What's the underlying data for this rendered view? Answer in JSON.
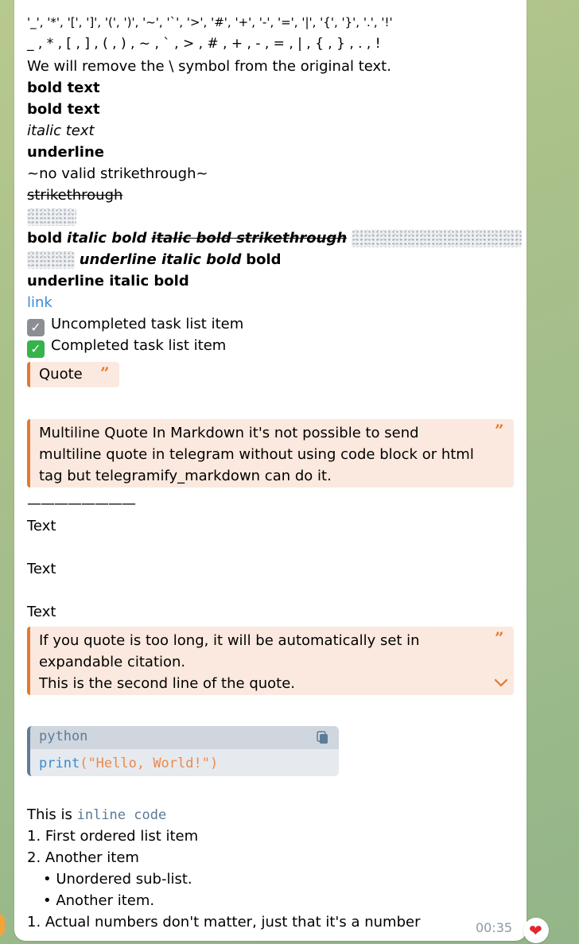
{
  "escaped_chars": "'_', '*', '[', ']', '(', ')', '~', '`', '>', '#', '+', '-', '=', '|', '{', '}', '.', '!'",
  "symbols_line": "_ , * , [ , ] , ( , ) , ~ , ` , > , # , + , - , = , | , { , } , . , !",
  "remove_backslash": "We will remove the \\ symbol from the original text.",
  "bold1": "bold text",
  "bold2": "bold text",
  "italic": "italic text",
  "underline": "underline",
  "no_strike": "~no valid strikethrough~",
  "strike": "strikethrough",
  "mixed_line": {
    "bold": "bold",
    "italic_bold": "italic bold",
    "italic_bold_strike": "italic bold strikethrough"
  },
  "mixed_line2": {
    "underline_italic_bold": "underline italic bold",
    "bold": "bold"
  },
  "underline_italic_bold": "underline italic bold",
  "link": "link",
  "tasks": [
    {
      "label": "Uncompleted task list item",
      "icon": "checkmark-grey-icon"
    },
    {
      "label": "Completed task list item",
      "icon": "checkmark-green-icon"
    }
  ],
  "quote_short": "Quote",
  "quote_multiline": [
    "Multiline Quote In Markdown it's not possible to send",
    "multiline quote in telegram without using code block or html",
    "tag but telegramify_markdown can do it."
  ],
  "hr": "————————",
  "text_lines": [
    "Text",
    "Text",
    "Text"
  ],
  "quote_expandable": [
    "If you quote is too long, it will be automatically set in",
    "expandable citation.",
    "This is the second line of the quote."
  ],
  "code": {
    "language": "python",
    "func": "print",
    "paren_open": "(",
    "string": "\"Hello, World!\"",
    "paren_close": ")"
  },
  "inline_code_prefix": "This is ",
  "inline_code": "inline code",
  "list": [
    "1. First ordered list item",
    "2. Another item",
    "• Unordered sub-list.",
    "• Another item.",
    "1. Actual numbers don't matter, just that it's a number"
  ],
  "time": "00:35",
  "reaction": "❤",
  "colors": {
    "quote_accent": "#e07a2f",
    "link": "#3a8ad6",
    "code_string": "#e98a4f",
    "code_func": "#3a8ad6"
  }
}
